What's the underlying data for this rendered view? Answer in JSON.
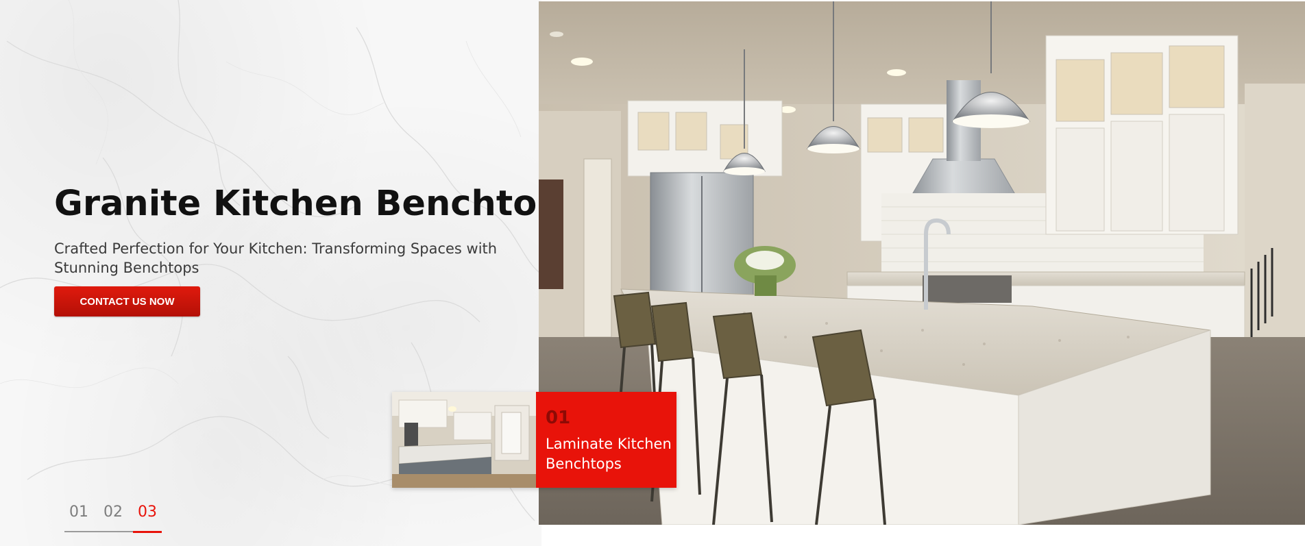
{
  "hero": {
    "title": "Granite Kitchen Benchtops",
    "subtitle": "Crafted Perfection for Your Kitchen: Transforming Spaces with Stunning Benchtops",
    "cta_label": "CONTACT US NOW"
  },
  "next_slide": {
    "number": "01",
    "label": "Laminate Kitchen Benchtops"
  },
  "pagination": {
    "pages": [
      "01",
      "02",
      "03"
    ],
    "active": "03"
  },
  "colors": {
    "accent": "#e8130a",
    "accent_dark": "#8e0a05",
    "title": "#111111",
    "text": "#3a3a3a"
  }
}
